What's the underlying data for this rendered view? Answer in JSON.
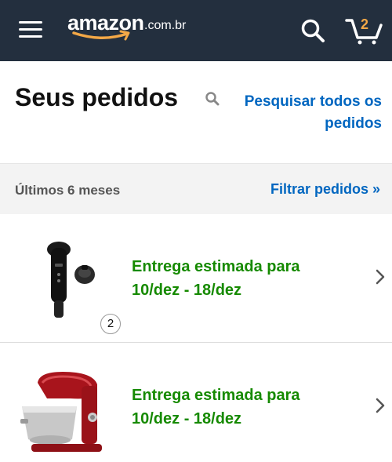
{
  "header": {
    "logo_word": "amazon",
    "logo_tld": ".com.br",
    "cart_count": "2",
    "colors": {
      "bar": "#232f3e",
      "smile": "#f3a847"
    }
  },
  "page": {
    "title": "Seus pedidos",
    "search_link_line1": "Pesquisar todos os",
    "search_link_line2": "pedidos"
  },
  "filter": {
    "period": "Últimos 6 meses",
    "link": "Filtrar pedidos »"
  },
  "orders": [
    {
      "status_line1": "Entrega estimada para",
      "status_line2": "10/dez - 18/dez",
      "quantity": "2",
      "image": "black-handheld-blender-icon"
    },
    {
      "status_line1": "Entrega estimada para",
      "status_line2": "10/dez - 18/dez",
      "image": "red-stand-mixer-icon"
    }
  ],
  "colors": {
    "link": "#0066c0",
    "delivery": "#168a00"
  }
}
